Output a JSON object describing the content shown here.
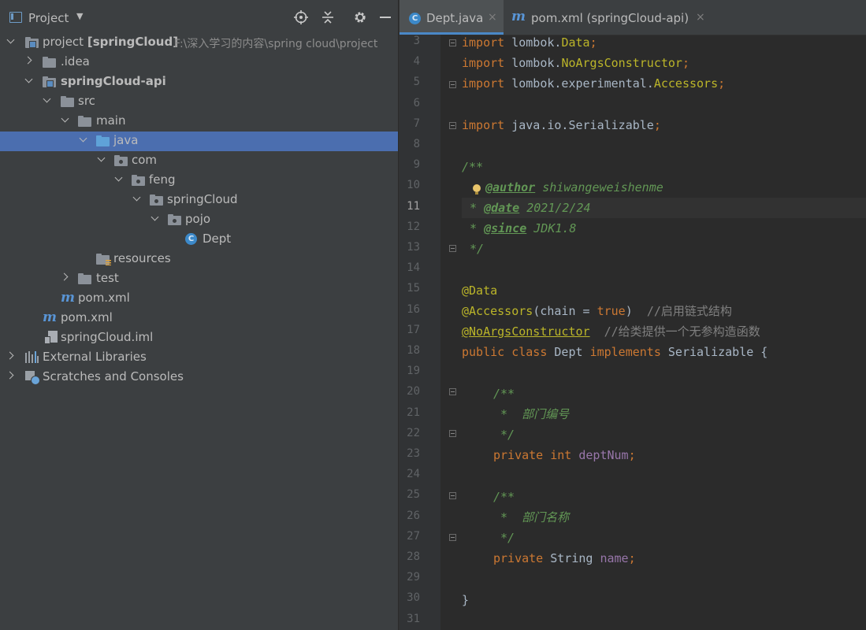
{
  "panel": {
    "title": "Project"
  },
  "tree": [
    {
      "label": "project",
      "bold_suffix": "[springCloud]",
      "path": "F:\\深入学习的内容\\spring cloud\\project",
      "icon": "module-folder-icon"
    },
    {
      "label": ".idea",
      "icon": "folder-icon"
    },
    {
      "label": "springCloud-api",
      "icon": "module-folder-icon"
    },
    {
      "label": "src",
      "icon": "folder-icon"
    },
    {
      "label": "main",
      "icon": "folder-icon"
    },
    {
      "label": "java",
      "icon": "source-folder-icon"
    },
    {
      "label": "com",
      "icon": "package-icon"
    },
    {
      "label": "feng",
      "icon": "package-icon"
    },
    {
      "label": "springCloud",
      "icon": "package-icon"
    },
    {
      "label": "pojo",
      "icon": "package-icon"
    },
    {
      "label": "Dept",
      "icon": "class-icon"
    },
    {
      "label": "resources",
      "icon": "resources-folder-icon"
    },
    {
      "label": "test",
      "icon": "folder-icon"
    },
    {
      "label": "pom.xml",
      "icon": "maven-icon"
    },
    {
      "label": "pom.xml",
      "icon": "maven-icon"
    },
    {
      "label": "springCloud.iml",
      "icon": "iml-file-icon"
    },
    {
      "label": "External Libraries",
      "icon": "libraries-icon"
    },
    {
      "label": "Scratches and Consoles",
      "icon": "scratches-icon"
    }
  ],
  "tabs": [
    {
      "label": "Dept.java",
      "close": "×",
      "icon": "class-icon"
    },
    {
      "label": "pom.xml (springCloud-api)",
      "close": "×",
      "icon": "maven-icon"
    }
  ],
  "editor": {
    "line_numbers": [
      "3",
      "4",
      "5",
      "6",
      "7",
      "8",
      "9",
      "10",
      "11",
      "12",
      "13",
      "14",
      "15",
      "16",
      "17",
      "18",
      "19",
      "20",
      "21",
      "22",
      "23",
      "24",
      "25",
      "26",
      "27",
      "28",
      "29",
      "30",
      "31"
    ],
    "current_line": "11",
    "code": {
      "l3a": "import",
      "l3b": " lombok.",
      "l3c": "Data",
      "l3d": ";",
      "l4a": "import",
      "l4b": " lombok.",
      "l4c": "NoArgsConstructor",
      "l4d": ";",
      "l5a": "import",
      "l5b": " lombok.experimental.",
      "l5c": "Accessors",
      "l5d": ";",
      "l7a": "import",
      "l7b": " java.io.Serializable",
      "l7c": ";",
      "l9": "/**",
      "l10a": "@author",
      "l10b": " shiwangeweishenme",
      "l11a": "* ",
      "l11b": "@date",
      "l11c": " 2021/2/24",
      "l12a": "* ",
      "l12b": "@since",
      "l12c": " JDK1.8",
      "l13": "*/",
      "l15": "@Data",
      "l16a": "@Accessors",
      "l16b": "(chain = ",
      "l16c": "true",
      "l16d": ")  ",
      "l16e": "//启用链式结构",
      "l17a": "@NoArgsConstructor",
      "l17b": "  ",
      "l17c": "//给类提供一个无参构造函数",
      "l18a": "public class",
      "l18b": " Dept ",
      "l18c": "implements",
      "l18d": " Serializable {",
      "l20": "/**",
      "l21": " *  部门编号",
      "l22": " */",
      "l23a": "private int",
      "l23b": " ",
      "l23c": "deptNum",
      "l23d": ";",
      "l25": "/**",
      "l26": " *  部门名称",
      "l27": " */",
      "l28a": "private",
      "l28b": " String ",
      "l28c": "name",
      "l28d": ";",
      "l30": "}"
    }
  }
}
